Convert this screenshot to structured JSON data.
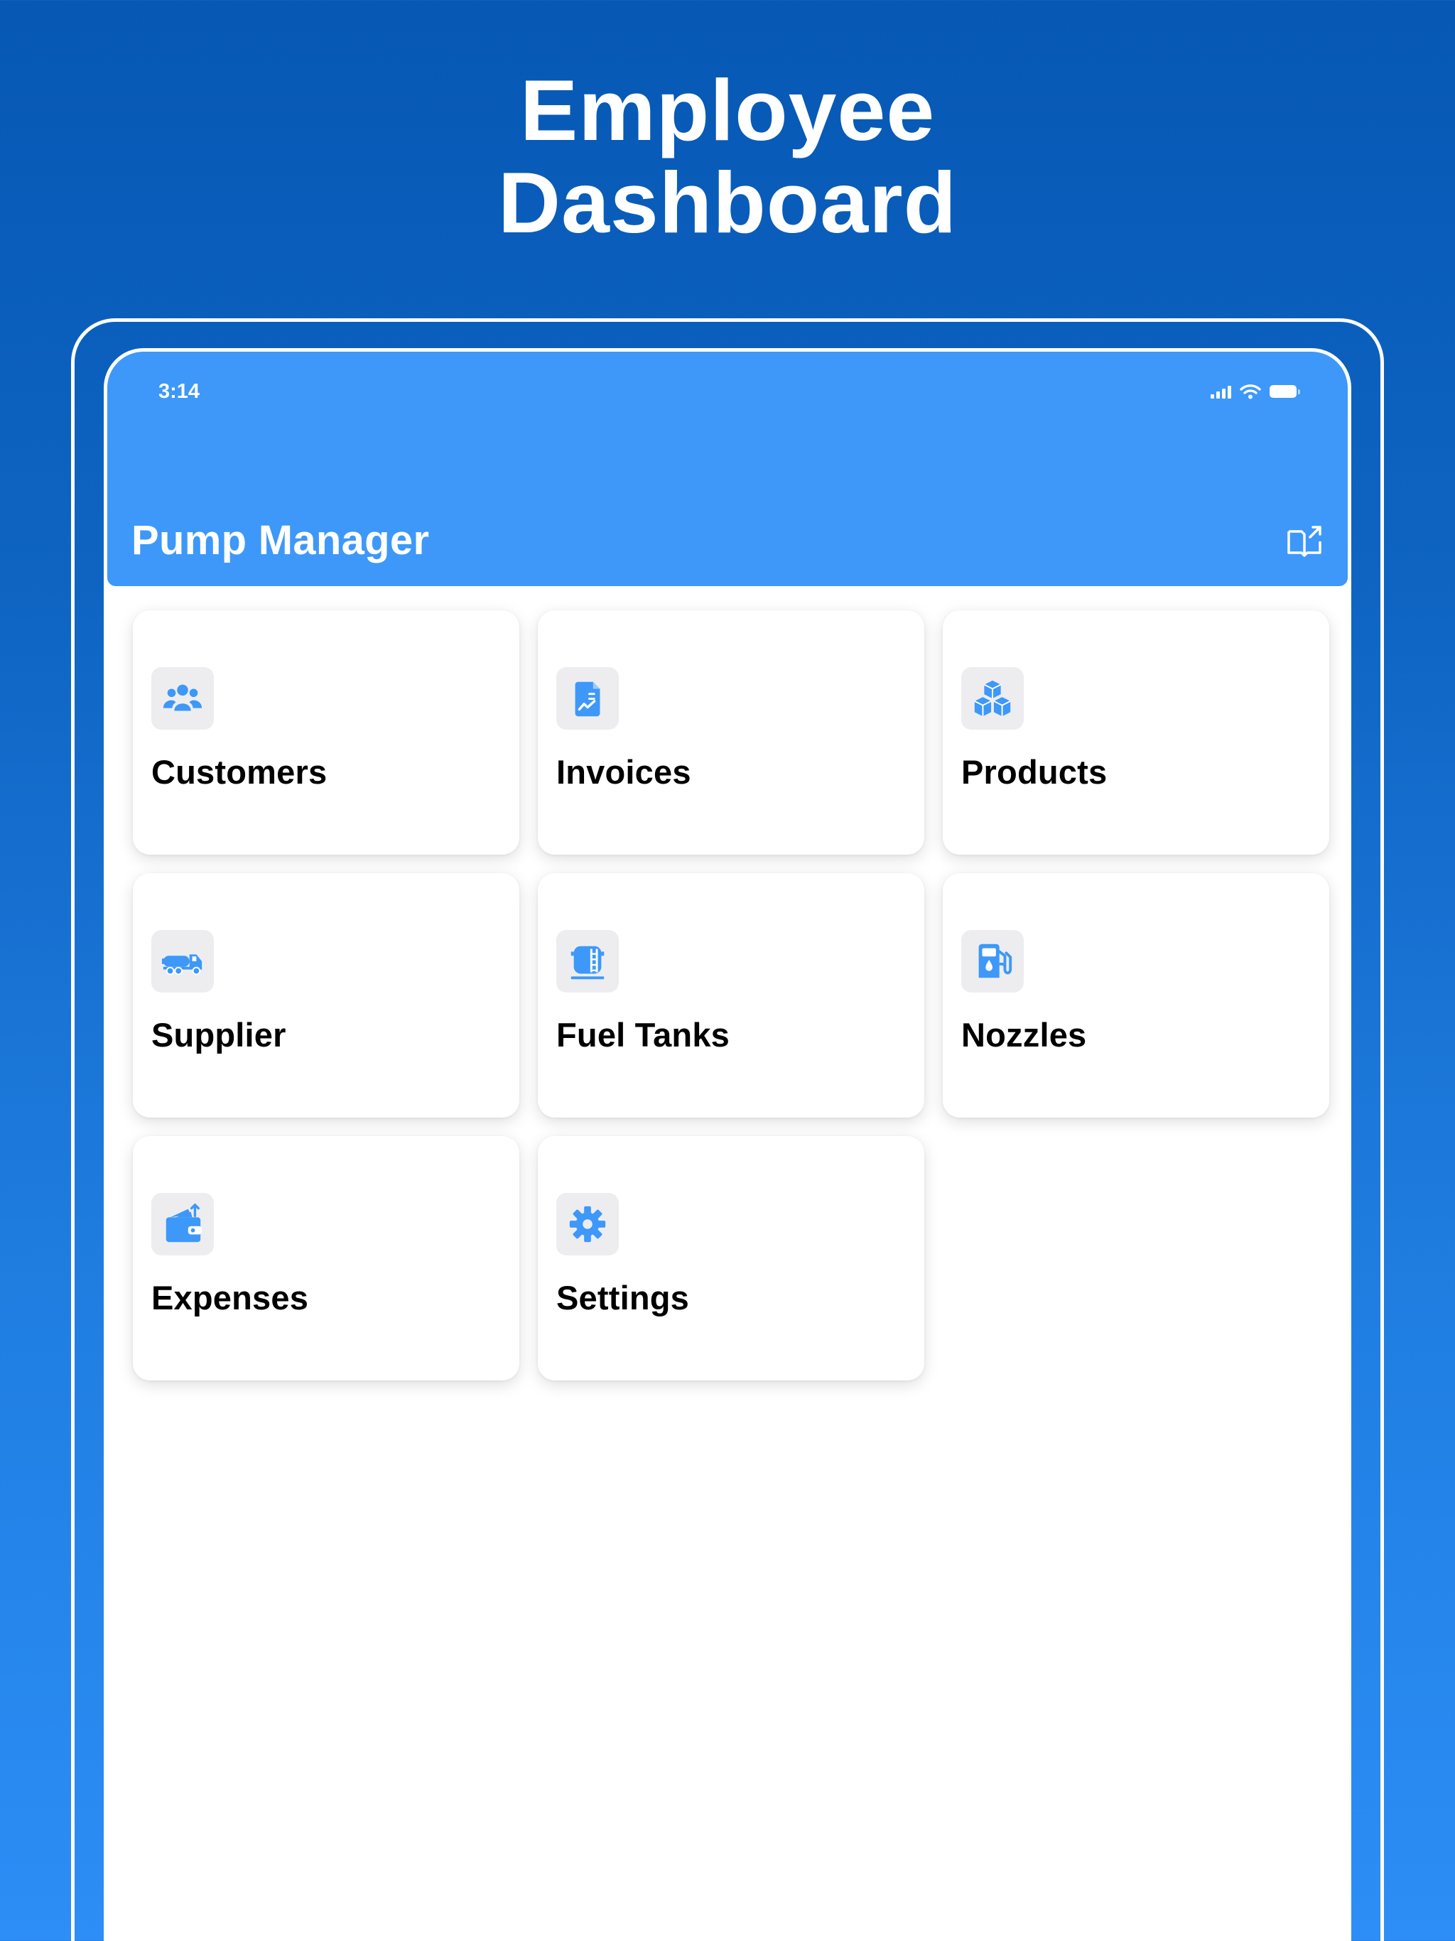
{
  "marketing": {
    "title_line1": "Employee",
    "title_line2": "Dashboard"
  },
  "status_bar": {
    "time": "3:14"
  },
  "header": {
    "title": "Pump Manager",
    "action_icon": "book-export-icon"
  },
  "colors": {
    "header": "#3d98f9",
    "icon_accent": "#3d98f9",
    "background_top": "#0658b4",
    "background_bottom": "#2c8ef6"
  },
  "menu": [
    {
      "label": "Customers",
      "icon": "users-icon"
    },
    {
      "label": "Invoices",
      "icon": "invoice-icon"
    },
    {
      "label": "Products",
      "icon": "boxes-icon"
    },
    {
      "label": "Supplier",
      "icon": "tanker-truck-icon"
    },
    {
      "label": "Fuel Tanks",
      "icon": "fuel-tank-icon"
    },
    {
      "label": "Nozzles",
      "icon": "fuel-pump-icon"
    },
    {
      "label": "Expenses",
      "icon": "wallet-icon"
    },
    {
      "label": "Settings",
      "icon": "gear-icon"
    }
  ]
}
